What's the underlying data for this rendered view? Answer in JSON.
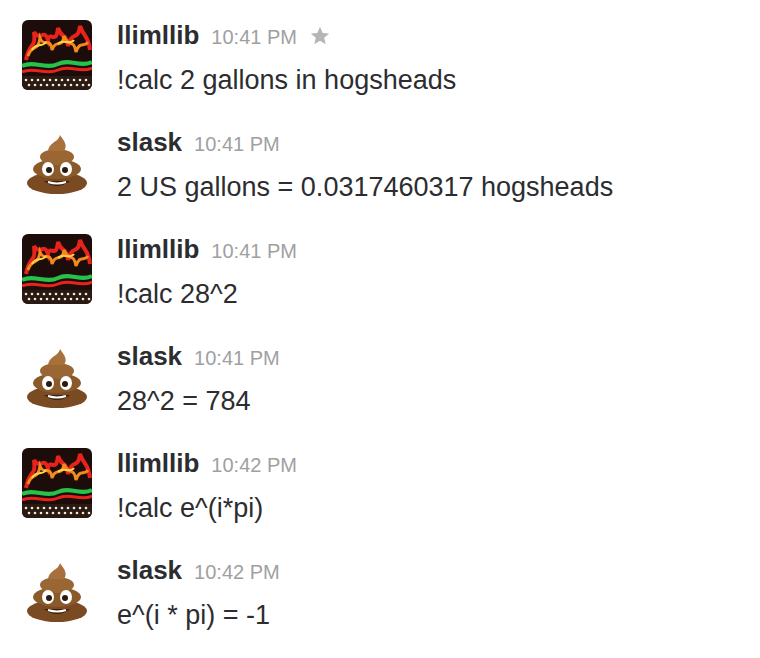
{
  "messages": [
    {
      "user": "llimllib",
      "time": "10:41 PM",
      "text": "!calc 2 gallons in hogsheads",
      "kind": "neon",
      "star_shown": true
    },
    {
      "user": "slask",
      "time": "10:41 PM",
      "text": "2 US gallons = 0.0317460317 hogsheads",
      "kind": "poop",
      "star_shown": false
    },
    {
      "user": "llimllib",
      "time": "10:41 PM",
      "text": "!calc 28^2",
      "kind": "neon",
      "star_shown": false
    },
    {
      "user": "slask",
      "time": "10:41 PM",
      "text": "28^2 = 784",
      "kind": "poop",
      "star_shown": false
    },
    {
      "user": "llimllib",
      "time": "10:42 PM",
      "text": "!calc e^(i*pi)",
      "kind": "neon",
      "star_shown": false
    },
    {
      "user": "slask",
      "time": "10:42 PM",
      "text": "e^(i * pi) = -1",
      "kind": "poop",
      "star_shown": false
    }
  ]
}
